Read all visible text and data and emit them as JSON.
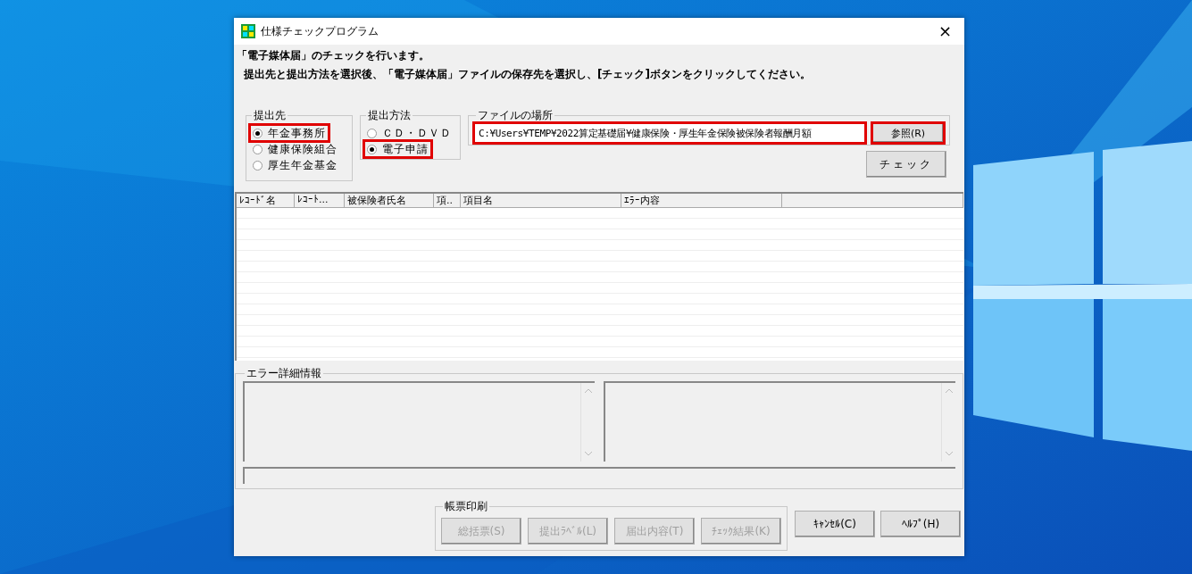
{
  "desktop": {
    "kind": "picture"
  },
  "window": {
    "title": "仕様チェックプログラム",
    "close": "×"
  },
  "intro": [
    "「電子媒体届」のチェックを行います。",
    "提出先と提出方法を選択後、「電子媒体届」ファイルの保存先を選択し、[チェック]ボタンをクリックしてください。"
  ],
  "destination": {
    "label": "提出先",
    "options": [
      {
        "label": "年金事務所",
        "selected": true,
        "highlighted": true
      },
      {
        "label": "健康保険組合",
        "selected": false,
        "highlighted": false
      },
      {
        "label": "厚生年金基金",
        "selected": false,
        "highlighted": false
      }
    ]
  },
  "method": {
    "label": "提出方法",
    "options": [
      {
        "label": "ＣＤ・ＤＶＤ",
        "selected": false,
        "highlighted": false
      },
      {
        "label": "電子申請",
        "selected": true,
        "highlighted": true
      }
    ]
  },
  "file_location": {
    "label": "ファイルの場所",
    "value": "C:¥Users¥TEMP¥2022算定基礎届¥健康保険・厚生年金保険被保険者報酬月額",
    "highlighted": true,
    "browse": {
      "label": "参照(R)",
      "highlighted": true
    }
  },
  "check_button": "チェック",
  "table": {
    "columns": [
      "ﾚｺｰﾄﾞ名",
      "ﾚｺｰﾄ...",
      "被保険者氏名",
      "項..",
      "項目名",
      "ｴﾗｰ内容"
    ]
  },
  "error_details": {
    "label": "エラー詳細情報"
  },
  "print": {
    "label": "帳票印刷",
    "buttons": [
      {
        "label": "総括票(S)",
        "disabled": true
      },
      {
        "label": "提出ﾗﾍﾞﾙ(L)",
        "disabled": true
      },
      {
        "label": "届出内容(T)",
        "disabled": true
      },
      {
        "label": "ﾁｪｯｸ結果(K)",
        "disabled": true
      }
    ]
  },
  "footer_buttons": [
    {
      "label": "ｷｬﾝｾﾙ(C)",
      "disabled": false
    },
    {
      "label": "ﾍﾙﾌﾟ(H)",
      "disabled": false
    }
  ]
}
